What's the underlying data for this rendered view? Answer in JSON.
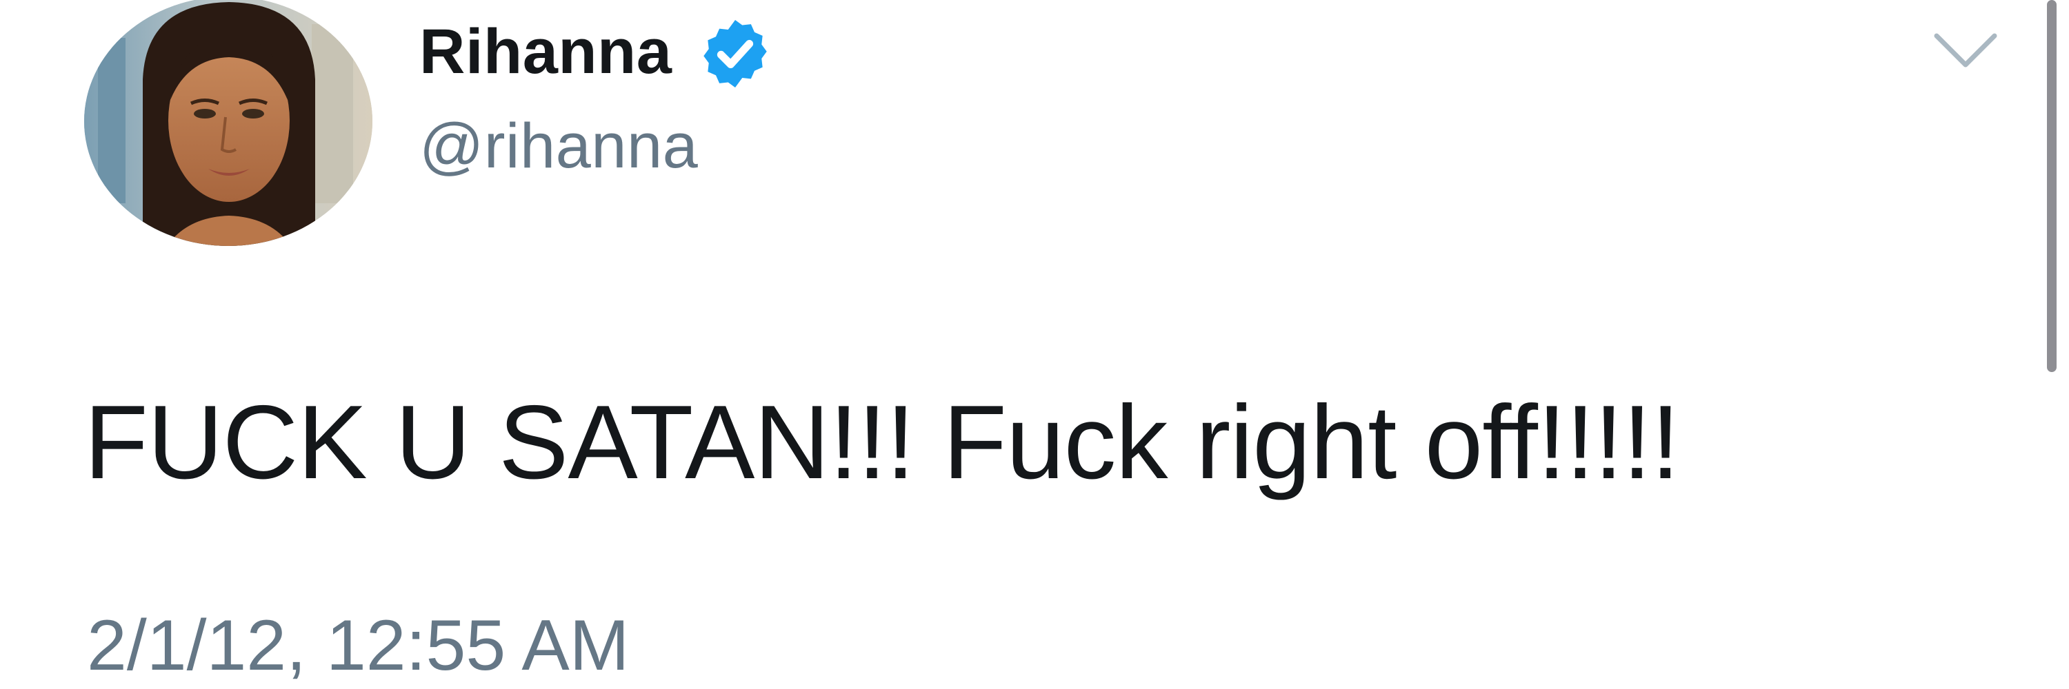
{
  "user": {
    "display_name": "Rihanna",
    "handle": "@rihanna",
    "verified_icon": "verified-badge-icon",
    "avatar_icon": "profile-photo"
  },
  "menu": {
    "icon": "chevron-down-icon"
  },
  "tweet": {
    "text": "FUCK U SATAN!!! Fuck right off!!!!!",
    "timestamp": "2/1/12, 12:55 AM"
  },
  "colors": {
    "text_primary": "#14171a",
    "text_secondary": "#657786",
    "verified_blue": "#1da1f2",
    "caret_gray": "#aab8c2",
    "scrollbar": "#8e8e93"
  }
}
